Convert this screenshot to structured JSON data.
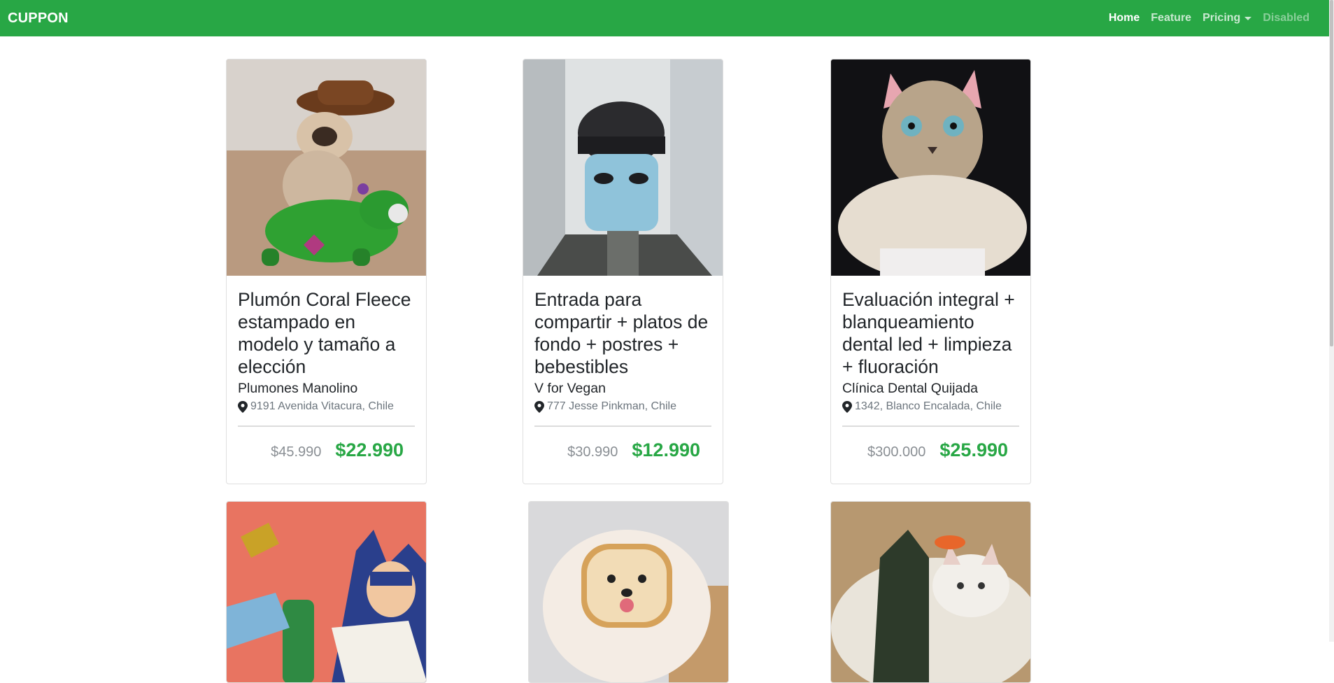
{
  "navbar": {
    "brand": "CUPPON",
    "links": [
      {
        "label": "Home"
      },
      {
        "label": "Feature"
      },
      {
        "label": "Pricing"
      },
      {
        "label": "Disabled"
      }
    ],
    "color": "#28a745"
  },
  "cards": [
    {
      "image": "pug-cowboy-hat-on-green-toy-horse",
      "title": "Plumón Coral Fleece estampado en modelo y tamaño a elección",
      "company": "Plumones Manolino",
      "address": "9191 Avenida Vitacura, Chile",
      "price_old": "$45.990",
      "price_new": "$22.990"
    },
    {
      "image": "man-with-surgical-mask-and-cap",
      "title": "Entrada para compartir + platos de fondo + postres + bebestibles",
      "company": "V for Vegan",
      "address": "777 Jesse Pinkman, Chile",
      "price_old": "$30.990",
      "price_new": "$12.990"
    },
    {
      "image": "cat-costume-face-with-fur-collar",
      "title": "Evaluación integral + blanqueamiento dental led + limpieza + fluoración",
      "company": "Clínica Dental Quijada",
      "address": "1342, Blanco Encalada, Chile",
      "price_old": "$300.000",
      "price_new": "$25.990"
    },
    {
      "image": "batman-comic-bottle-slap"
    },
    {
      "image": "pomeranian-dog-bread-slice"
    },
    {
      "image": "cat-sushi-roll"
    }
  ],
  "icons": {
    "pin": "map-marker-icon",
    "caret": "caret-down-icon"
  }
}
